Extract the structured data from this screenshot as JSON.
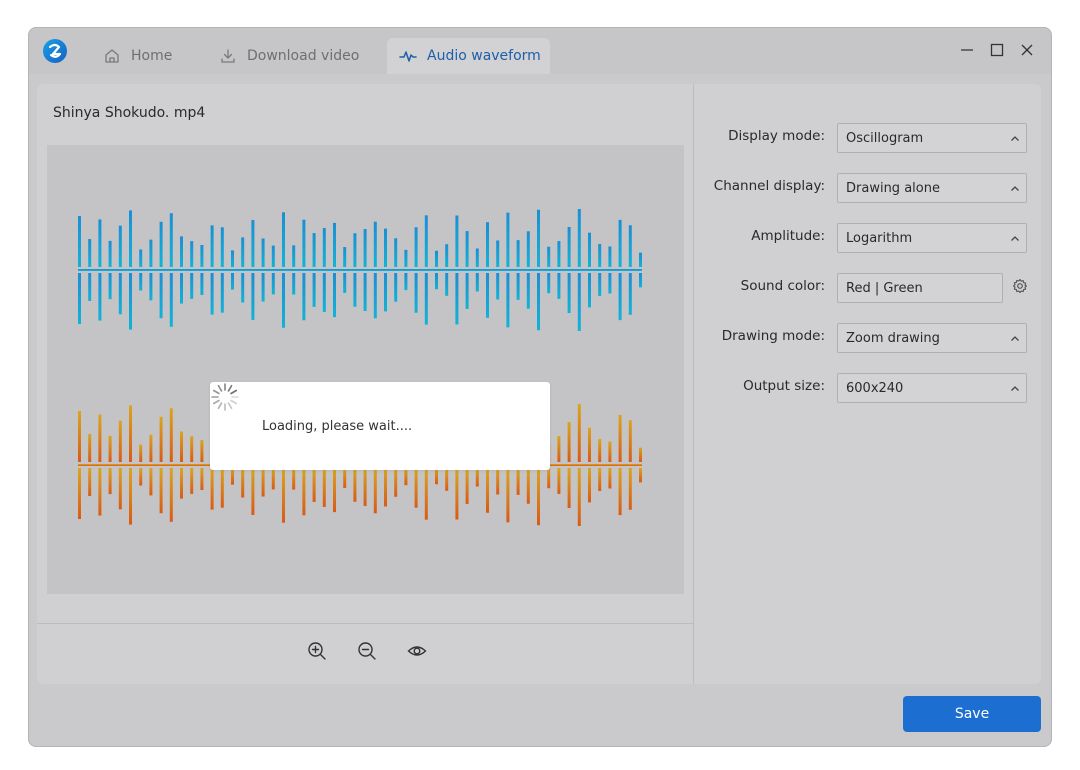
{
  "tabs": {
    "home": "Home",
    "download": "Download video",
    "audio": "Audio waveform"
  },
  "file": {
    "name": "Shinya Shokudo. mp4"
  },
  "loading": {
    "text": "Loading, please wait...."
  },
  "settings": {
    "display_mode": {
      "label": "Display mode:",
      "value": "Oscillogram"
    },
    "channel_display": {
      "label": "Channel display:",
      "value": "Drawing alone"
    },
    "amplitude": {
      "label": "Amplitude:",
      "value": "Logarithm"
    },
    "sound_color": {
      "label": "Sound color:",
      "value": "Red | Green"
    },
    "drawing_mode": {
      "label": "Drawing mode:",
      "value": "Zoom drawing"
    },
    "output_size": {
      "label": "Output size:",
      "value": "600x240"
    }
  },
  "actions": {
    "save": "Save"
  },
  "colors": {
    "accent": "#1c6fd0",
    "active_tab_text": "#1d5fa8",
    "wave_top_start": "#1a8fd4",
    "wave_top_end": "#12b3d6",
    "wave_bottom_start": "#d9a520",
    "wave_bottom_end": "#d95a16"
  },
  "icons": {
    "logo": "app-logo-icon",
    "home": "home-icon",
    "download": "download-icon",
    "audio": "waveform-icon",
    "minimize": "minimize-icon",
    "maximize": "maximize-icon",
    "close": "close-icon",
    "zoom_in": "zoom-in-icon",
    "zoom_out": "zoom-out-icon",
    "preview": "eye-icon",
    "settings": "gear-icon",
    "dropdown": "chevron-up-icon",
    "spinner": "spinner-icon"
  }
}
